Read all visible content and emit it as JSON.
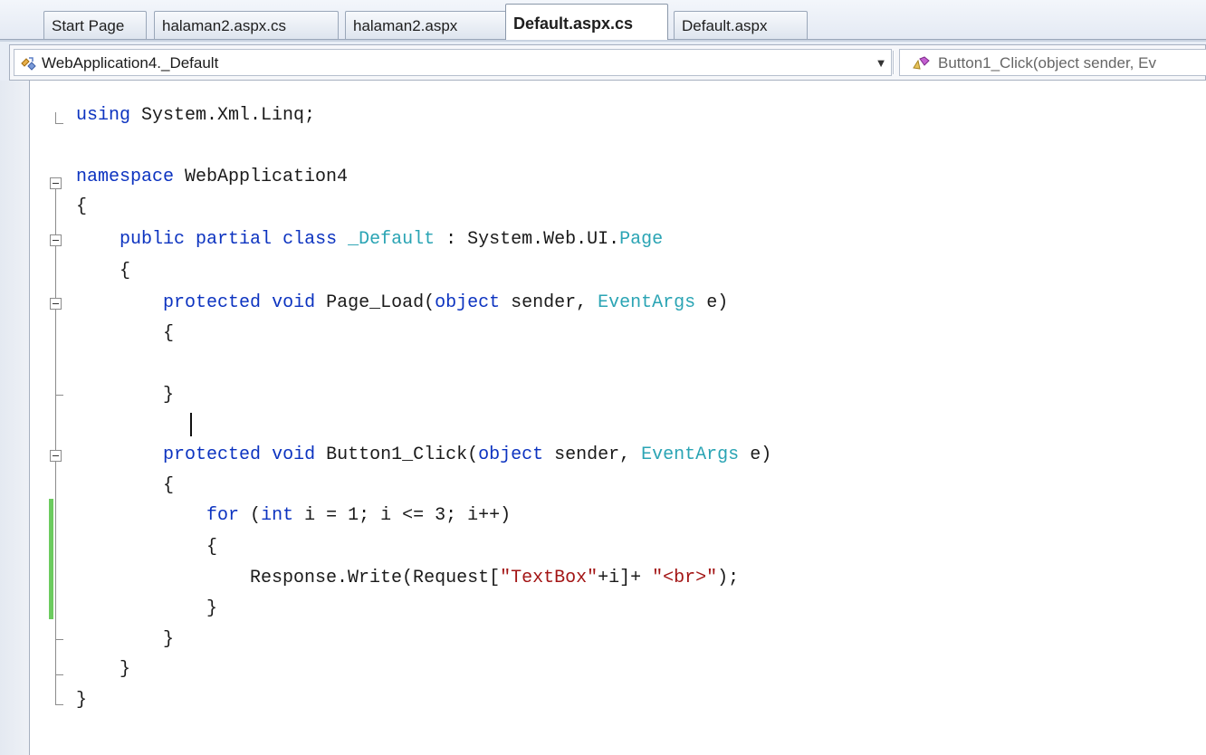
{
  "tabs": [
    {
      "label": "Start Page",
      "active": false
    },
    {
      "label": "halaman2.aspx.cs",
      "active": false
    },
    {
      "label": "halaman2.aspx",
      "active": false
    },
    {
      "label": "Default.aspx.cs",
      "active": true
    },
    {
      "label": "Default.aspx",
      "active": false
    }
  ],
  "navbar": {
    "type_combo": {
      "value": "WebApplication4._Default",
      "icon": "class-icon"
    },
    "member_combo": {
      "value": "Button1_Click(object sender, Ev",
      "icon": "method-icon"
    }
  },
  "editor": {
    "lines": [
      "using System.Xml.Linq;",
      "",
      "namespace WebApplication4",
      "{",
      "    public partial class _Default : System.Web.UI.Page",
      "    {",
      "        protected void Page_Load(object sender, EventArgs e)",
      "        {",
      "",
      "        }",
      "",
      "        protected void Button1_Click(object sender, EventArgs e)",
      "        {",
      "            for (int i = 1; i <= 3; i++)",
      "            {",
      "                Response.Write(Request[\"TextBox\"+i]+ \"<br>\");",
      "            }",
      "        }",
      "    }",
      "}"
    ]
  },
  "colors": {
    "keyword": "#0c33c0",
    "type": "#2aa4b4",
    "string": "#a31515",
    "changed_marker": "#6ccb5f"
  }
}
